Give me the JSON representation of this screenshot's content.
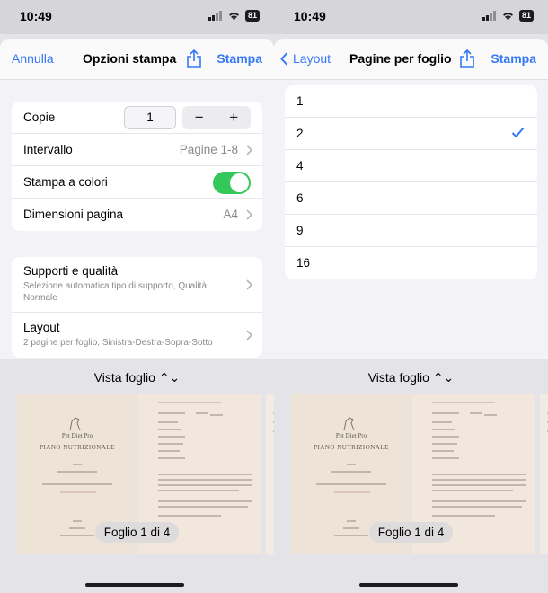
{
  "status": {
    "time": "10:49",
    "battery": "81"
  },
  "left": {
    "nav": {
      "cancel": "Annulla",
      "title": "Opzioni stampa",
      "print": "Stampa"
    },
    "settings": {
      "copies_label": "Copie",
      "copies_value": "1",
      "minus": "−",
      "plus": "+",
      "range_label": "Intervallo",
      "range_value": "Pagine 1-8",
      "color_label": "Stampa a colori",
      "color_on": true,
      "size_label": "Dimensioni pagina",
      "size_value": "A4"
    },
    "quality": {
      "label": "Supporti e qualità",
      "sub": "Selezione automatica tipo di supporto, Qualità Normale"
    },
    "layout": {
      "label": "Layout",
      "sub": "2 pagine per foglio, Sinistra-Destra-Sopra-Sotto"
    }
  },
  "right": {
    "nav": {
      "back": "Layout",
      "title": "Pagine per foglio",
      "print": "Stampa"
    },
    "options": [
      "1",
      "2",
      "4",
      "6",
      "9",
      "16"
    ],
    "selected": "2"
  },
  "preview": {
    "view_label": "Vista foglio",
    "sheet_counter": "Foglio 1 di 4",
    "page_brand": "Pet Diet Pro",
    "page_title": "PIANO NUTRIZIONALE"
  },
  "colors": {
    "accent": "#3478f6",
    "toggle_on": "#34c759"
  }
}
